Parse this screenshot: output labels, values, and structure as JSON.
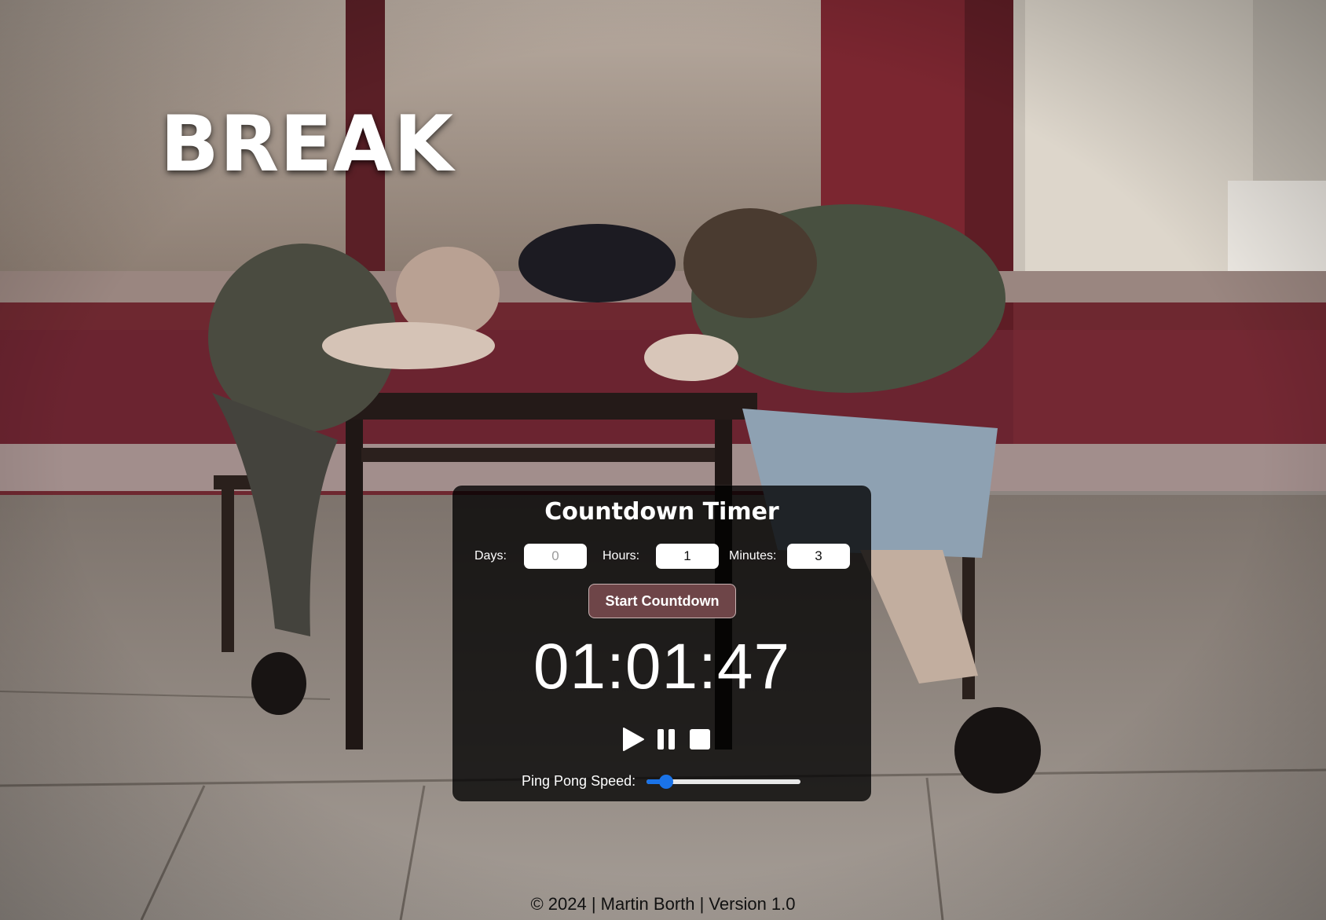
{
  "page": {
    "title": "BREAK"
  },
  "timer": {
    "title": "Countdown Timer",
    "fields": [
      {
        "label": "Days:",
        "value": "",
        "placeholder": "0"
      },
      {
        "label": "Hours:",
        "value": "1",
        "placeholder": ""
      },
      {
        "label": "Minutes:",
        "value": "3",
        "placeholder": ""
      }
    ],
    "start_label": "Start Countdown",
    "display": "01:01:47",
    "controls": [
      {
        "name": "play-icon"
      },
      {
        "name": "pause-icon"
      },
      {
        "name": "stop-icon"
      }
    ],
    "speed": {
      "label": "Ping Pong Speed:",
      "level": 0.13
    }
  },
  "footer": {
    "text": "© 2024 | Martin Borth | Version 1.0"
  },
  "colors": {
    "panel_bg": "#000000",
    "start_button": "#6e4548",
    "slider_accent": "#1a73e8",
    "storefront": "#7a2a33"
  }
}
